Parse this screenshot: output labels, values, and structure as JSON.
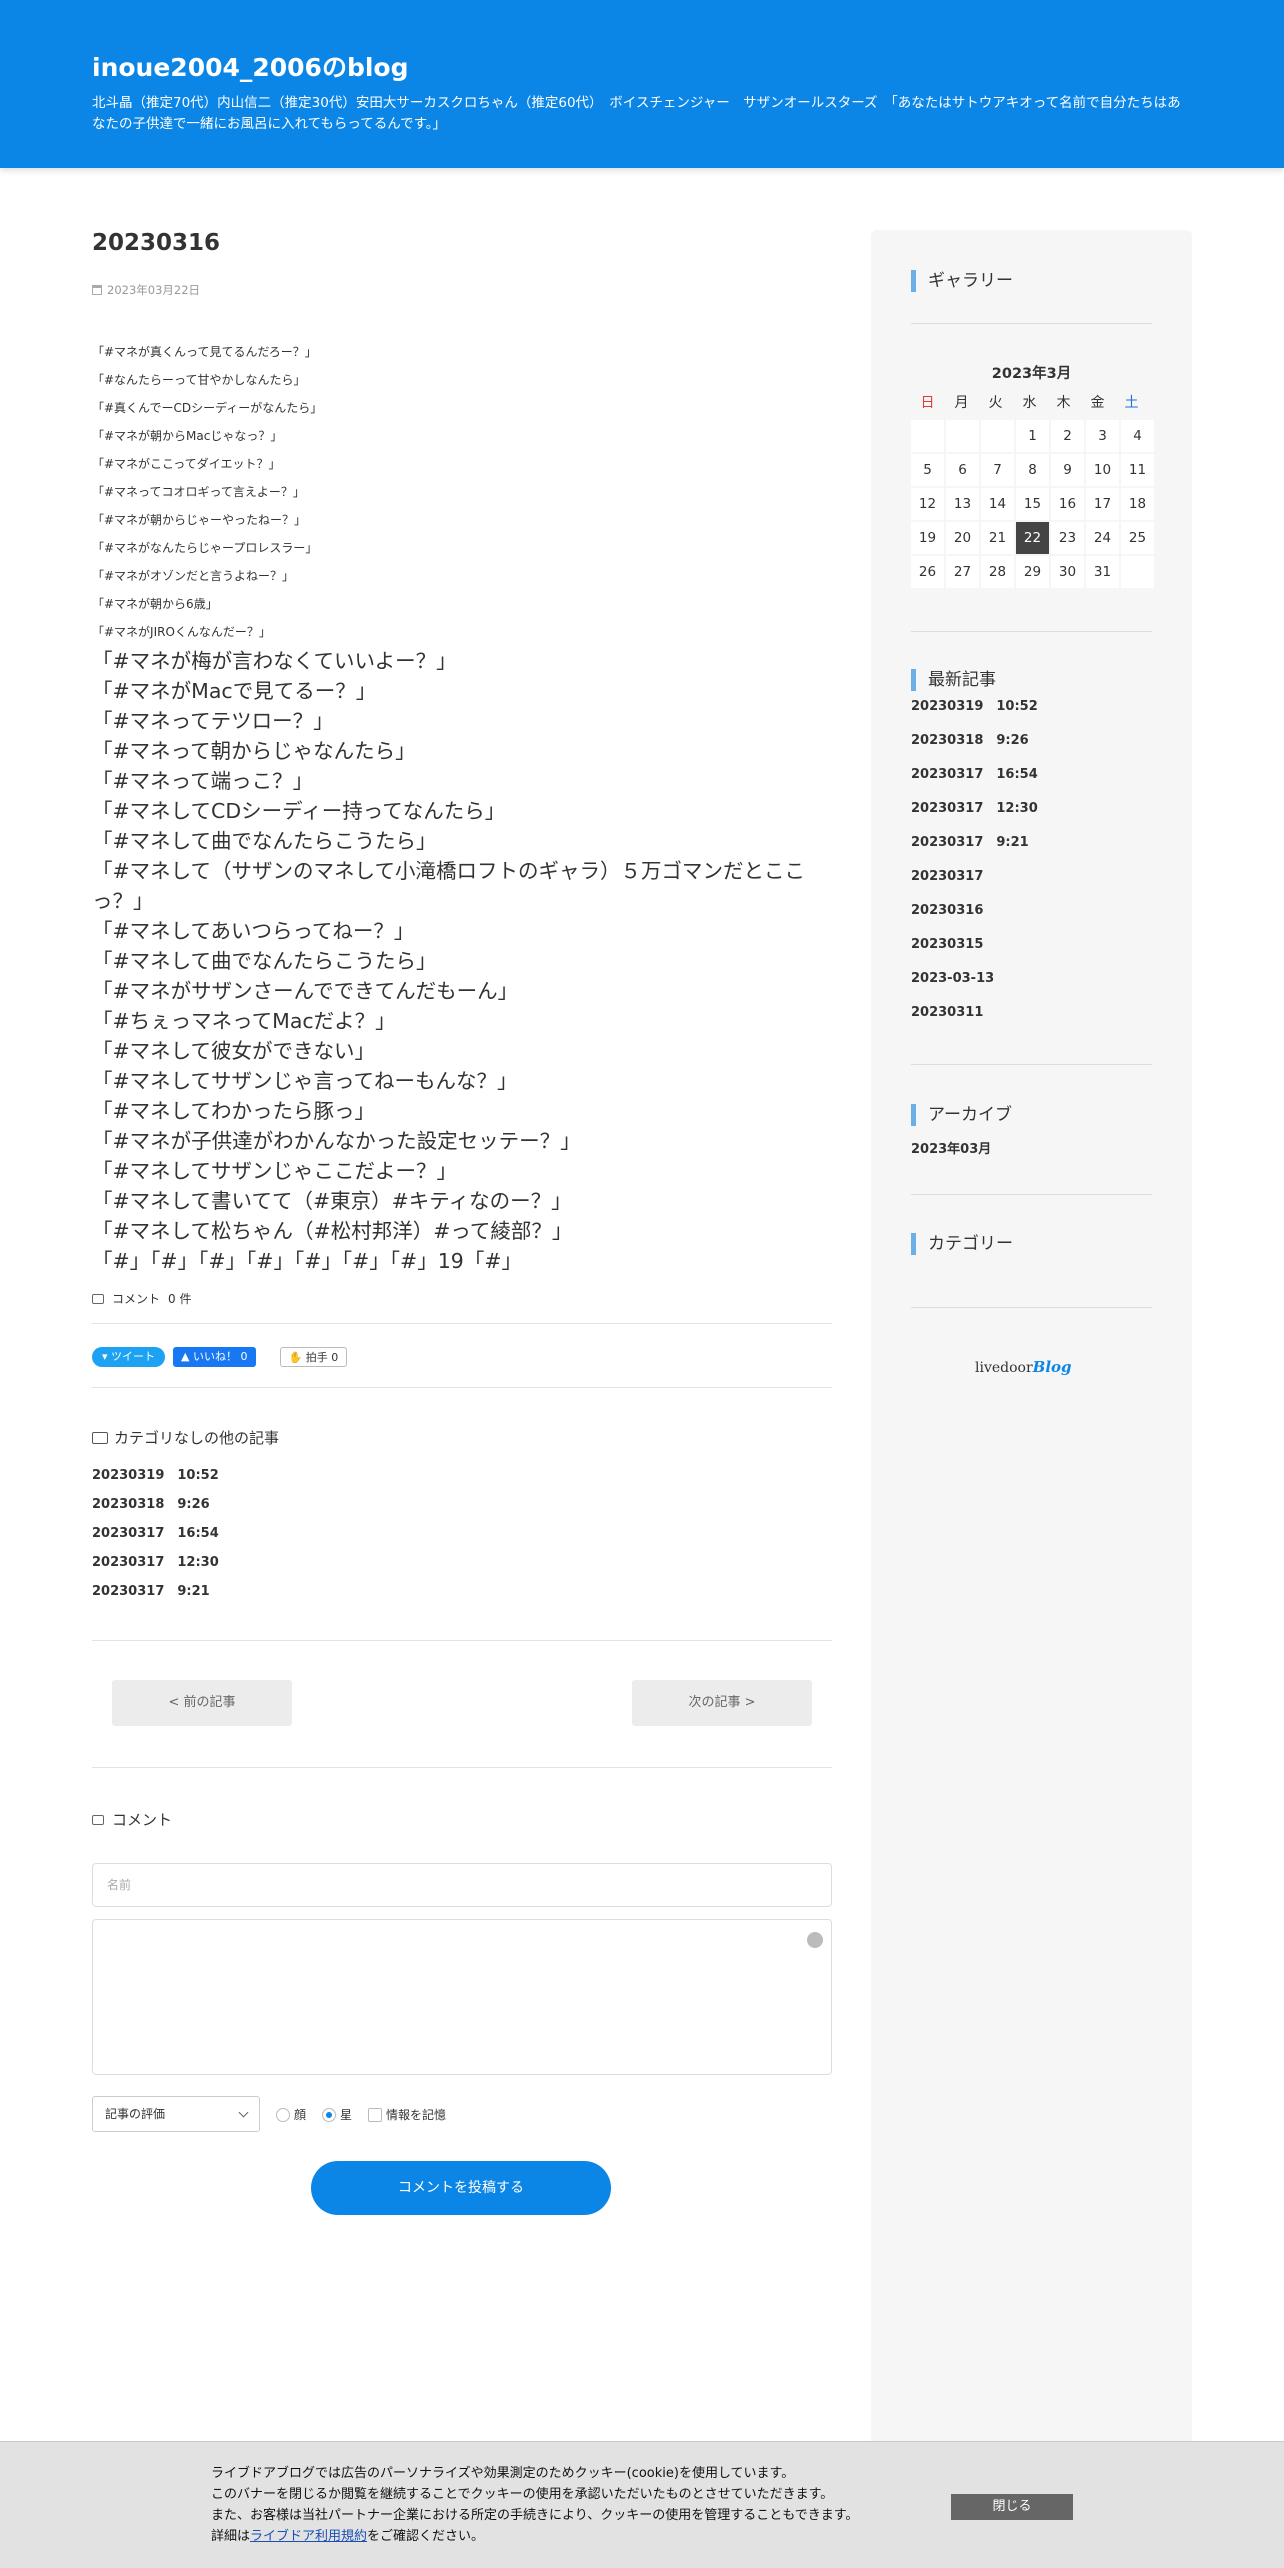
{
  "header": {
    "title": "inoue2004_2006のblog",
    "description": "北斗晶（推定70代）内山信二（推定30代）安田大サーカスクロちゃん（推定60代）　ボイスチェンジャー　サザンオールスターズ　「あなたはサトウアキオって名前で自分たちはあなたの子供達で一緒にお風呂に入れてもらってるんです。」"
  },
  "article": {
    "title": "20230316",
    "date": "2023年03月22日",
    "small_lines": [
      "「#マネが真くんって見てるんだろー？」",
      "「#なんたらーって甘やかしなんたら」",
      "「#真くんでーCDシーディーがなんたら」",
      "「#マネが朝からMacじゃなっ？」",
      "「#マネがここってダイエット？」",
      "「#マネってコオロギって言えよー？」",
      "「#マネが朝からじゃーやったねー？」",
      "「#マネがなんたらじゃープロレスラー」",
      "「#マネがオゾンだと言うよねー？」",
      "「#マネが朝から6歳」",
      "「#マネがJIROくんなんだー？」"
    ],
    "big_lines": [
      "「#マネが梅が言わなくていいよー？」",
      "「#マネがMacで見てるー？」",
      "「#マネってテツロー？」",
      "「#マネって朝からじゃなんたら」",
      "「#マネって端っこ？」",
      "「#マネしてCDシーディー持ってなんたら」",
      "「#マネして曲でなんたらこうたら」",
      "「#マネして（サザンのマネして小滝橋ロフトのギャラ）５万ゴマンだとここっ？」",
      "「#マネしてあいつらってねー？」",
      "「#マネして曲でなんたらこうたら」",
      "「#マネがサザンさーんでできてんだもーん」",
      "「#ちぇっマネってMacだよ？」",
      "「#マネして彼女ができない」",
      "「#マネしてサザンじゃ言ってねーもんな？」",
      "「#マネしてわかったら豚っ」",
      "「#マネが子供達がわかんなかった設定セッテー？」",
      "「#マネしてサザンじゃここだよー？」",
      "「#マネして書いてて（#東京）#キティなのー？」",
      "「#マネして松ちゃん（#松村邦洋）#って綾部？」",
      "「#」「#」「#」「#」「#」「#」「#」19「#」"
    ],
    "comment_count_label": "コメント",
    "comment_count": "0 件"
  },
  "social": {
    "tweet": "ツイート",
    "like": "いいね！ 0",
    "clap": "拍手 0"
  },
  "related": {
    "heading": "カテゴリなしの他の記事",
    "items": [
      "20230319　10:52",
      "20230318　9:26",
      "20230317　16:54",
      "20230317　12:30",
      "20230317　9:21"
    ]
  },
  "pager": {
    "prev": "< 前の記事",
    "next": "次の記事 >"
  },
  "comment_form": {
    "heading": "コメント",
    "name_placeholder": "名前",
    "rating_label": "記事の評価",
    "opt_face": "顔",
    "opt_star": "星",
    "opt_remember": "情報を記憶",
    "submit": "コメントを投稿する"
  },
  "sidebar": {
    "gallery_heading": "ギャラリー",
    "calendar_title": "2023年3月",
    "weekdays": [
      "日",
      "月",
      "火",
      "水",
      "木",
      "金",
      "土"
    ],
    "weekday_colors": {
      "sun": "#e53935",
      "sat": "#1e6fd9"
    },
    "days": [
      "",
      "",
      "",
      "1",
      "2",
      "3",
      "4",
      "5",
      "6",
      "7",
      "8",
      "9",
      "10",
      "11",
      "12",
      "13",
      "14",
      "15",
      "16",
      "17",
      "18",
      "19",
      "20",
      "21",
      "22",
      "23",
      "24",
      "25",
      "26",
      "27",
      "28",
      "29",
      "30",
      "31",
      ""
    ],
    "today": "22",
    "recent_heading": "最新記事",
    "recent_items": [
      "20230319　10:52",
      "20230318　9:26",
      "20230317　16:54",
      "20230317　12:30",
      "20230317　9:21",
      "20230317",
      "20230316",
      "20230315",
      "2023-03-13",
      "20230311"
    ],
    "archive_heading": "アーカイブ",
    "archive_item": "2023年03月",
    "category_heading": "カテゴリー",
    "logo_text": "livedoor",
    "logo_blog": "Blog"
  },
  "cookie": {
    "line1": "ライブドアブログでは広告のパーソナライズや効果測定のためクッキー(cookie)を使用しています。",
    "line2": "このバナーを閉じるか閲覧を継続することでクッキーの使用を承認いただいたものとさせていただきます。",
    "line3": "また、お客様は当社パートナー企業における所定の手続きにより、クッキーの使用を管理することもできます。",
    "line4_pre": "詳細は",
    "line4_link": "ライブドア利用規約",
    "line4_post": "をご確認ください。",
    "close": "閉じる"
  },
  "colors": {
    "header_bg": "#0b86e6",
    "accent": "#6aafe6"
  }
}
